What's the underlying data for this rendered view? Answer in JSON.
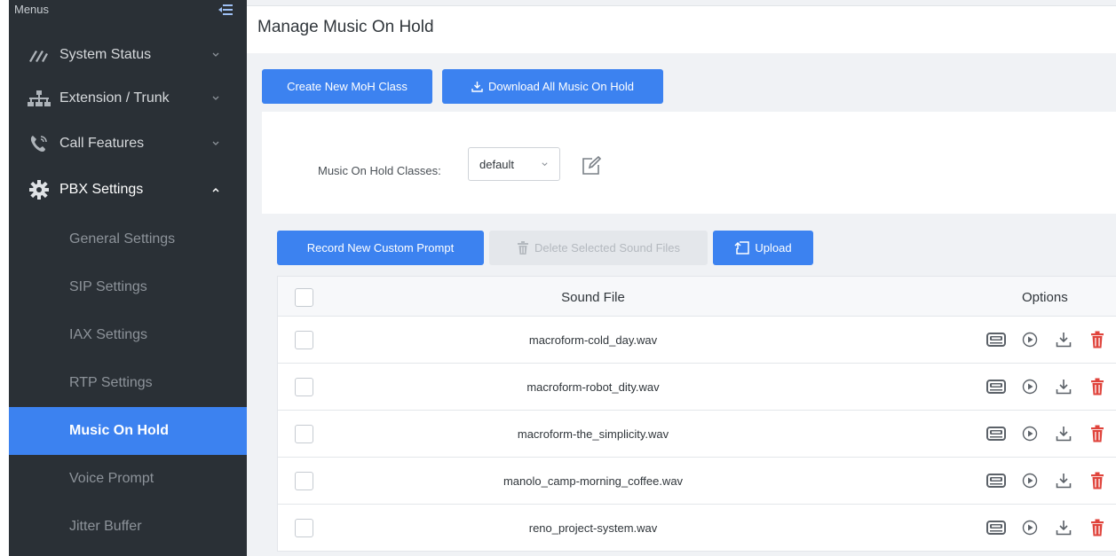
{
  "sidebar": {
    "menus_label": "Menus",
    "items": [
      {
        "label": "System Status",
        "icon": "gauge-icon"
      },
      {
        "label": "Extension / Trunk",
        "icon": "network-icon"
      },
      {
        "label": "Call Features",
        "icon": "phone-icon"
      },
      {
        "label": "PBX Settings",
        "icon": "gear-icon"
      }
    ],
    "sub_items": [
      {
        "label": "General Settings"
      },
      {
        "label": "SIP Settings"
      },
      {
        "label": "IAX Settings"
      },
      {
        "label": "RTP Settings"
      },
      {
        "label": "Music On Hold"
      },
      {
        "label": "Voice Prompt"
      },
      {
        "label": "Jitter Buffer"
      }
    ]
  },
  "header": {
    "title": "Manage Music On Hold"
  },
  "toolbar": {
    "create_label": "Create New MoH Class",
    "download_all_label": "Download All Music On Hold"
  },
  "moh": {
    "classes_label": "Music On Hold Classes:",
    "selected_class": "default"
  },
  "actions": {
    "record_label": "Record New Custom Prompt",
    "delete_label": "Delete Selected Sound Files",
    "upload_label": "Upload"
  },
  "table": {
    "col_sound_file": "Sound File",
    "col_options": "Options",
    "rows": [
      {
        "file": "macroform-cold_day.wav"
      },
      {
        "file": "macroform-robot_dity.wav"
      },
      {
        "file": "macroform-the_simplicity.wav"
      },
      {
        "file": "manolo_camp-morning_coffee.wav"
      },
      {
        "file": "reno_project-system.wav"
      }
    ]
  },
  "colors": {
    "accent": "#3c82f0",
    "sidebar_bg": "#2a3036",
    "delete_red": "#e0443c"
  }
}
